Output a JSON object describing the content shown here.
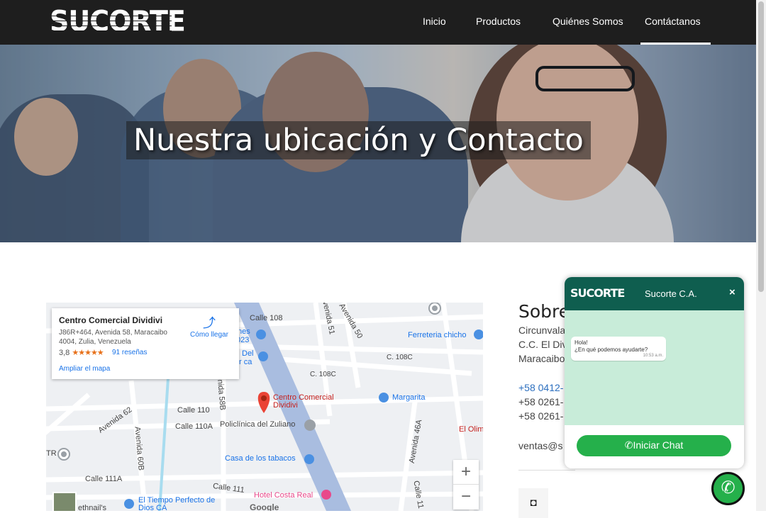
{
  "header": {
    "logo": "SUCORTE",
    "nav": [
      {
        "label": "Inicio"
      },
      {
        "label": "Productos"
      },
      {
        "label": "Quiénes Somos"
      },
      {
        "label": "Contáctanos"
      }
    ],
    "active": "Contáctanos"
  },
  "hero": {
    "title": "Nuestra ubicación y Contacto"
  },
  "map": {
    "place_name": "Centro Comercial Dividivi",
    "address": "J86R+464, Avenida 58, Maracaibo 4004, Zulia, Venezuela",
    "rating": "3,8",
    "stars": "★★★★★",
    "reviews": "91 reseñas",
    "directions": "Cómo llegar",
    "enlarge": "Ampliar el mapa",
    "labels": {
      "calle108": "Calle 108",
      "ave51": "Avenida 51",
      "ave50": "Avenida 50",
      "ferreteria": "Ferreteria chicho",
      "c108c_a": "C. 108C",
      "c108c_b": "C. 108C",
      "ave62": "Avenida 62",
      "calle110": "Calle 110",
      "ave58b": "Avenida 58B",
      "marker": "Centro Comercial Dividivi",
      "margarita": "Margarita",
      "calle110a": "Calle 110A",
      "policlinica": "Policlínica del Zuliano",
      "ave60b": "Avenida 60B",
      "ave46a": "Avenida 46A",
      "elolim": "El Olim",
      "tr": "TR",
      "tabacos": "Casa de los tabacos",
      "calle111a": "Calle 111A",
      "calle111": "Calle 111",
      "tiempo": "El Tiempo Perfecto de Dios CA",
      "costareal": "Hotel Costa Real",
      "hethnail": "ethnail's",
      "nes": "nes",
      "n023": "023",
      "del": "Del",
      "rca": "r ca",
      "calle11": "Calle 11"
    },
    "google": "Google",
    "zoom_in": "+",
    "zoom_out": "−"
  },
  "info": {
    "heading": "Sobre",
    "addr1": "Circunvala",
    "addr2": "C.C. El Div",
    "addr3": "Maracaibo",
    "phone1": "+58 0412-",
    "phone2": "+58 0261-",
    "phone3": "+58 0261-",
    "email": "ventas@s"
  },
  "chat": {
    "logo": "SUCORTE",
    "name": "Sucorte C.A.",
    "close": "×",
    "greeting1": "Hola!",
    "greeting2": "¿En qué podemos ayudarte?",
    "time": "10:53 a.m.",
    "button": "Iniciar Chat"
  },
  "colors": {
    "header_bg": "#1e1e1e",
    "chat_header": "#0f5e4f",
    "chat_body": "#c8ecd9",
    "whatsapp_green": "#25b04b",
    "link_blue": "#2c6fbf"
  },
  "icons": [
    "instagram-icon",
    "whatsapp-icon",
    "directions-icon",
    "map-marker-icon"
  ]
}
